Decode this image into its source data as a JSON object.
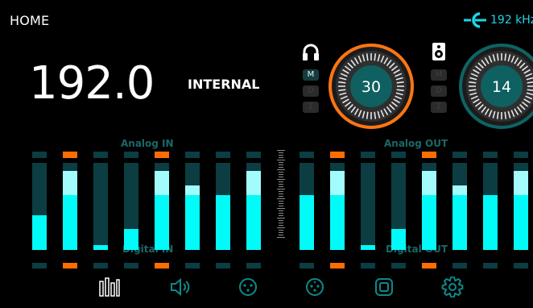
{
  "header": {
    "title": "HOME",
    "sample_rate": "192 kHz"
  },
  "source": {
    "frequency": "192.0",
    "clock": "INTERNAL"
  },
  "headphone": {
    "icon": "headphones-icon",
    "volume": "30",
    "modes": [
      "M",
      "D",
      "Σ"
    ],
    "active_mode": 0
  },
  "speaker": {
    "icon": "speaker-icon",
    "volume": "14",
    "modes": [
      "M",
      "D",
      "Σ"
    ],
    "active_mode": -1
  },
  "sections": {
    "analog_in": "Analog IN",
    "analog_out": "Analog OUT",
    "digital_in": "Digital IN",
    "digital_out": "Digital OUT"
  },
  "colors": {
    "accent": "#00fbf9",
    "peak": "#ff6d00",
    "bar_bg": "#0b3d42",
    "ring": "#ff7512"
  },
  "meters": {
    "inputs": [
      {
        "level": 0.4,
        "hold": 0.4,
        "peak": false,
        "digital": false
      },
      {
        "level": 0.63,
        "hold": 0.91,
        "peak": true,
        "digital": true
      },
      {
        "level": 0.06,
        "hold": 0.06,
        "peak": false,
        "digital": false
      },
      {
        "level": 0.24,
        "hold": 0.24,
        "peak": false,
        "digital": false
      },
      {
        "level": 0.63,
        "hold": 0.91,
        "peak": true,
        "digital": true
      },
      {
        "level": 0.63,
        "hold": 0.74,
        "peak": false,
        "digital": false
      },
      {
        "level": 0.63,
        "hold": 0.63,
        "peak": false,
        "digital": false
      },
      {
        "level": 0.63,
        "hold": 0.91,
        "peak": false,
        "digital": false
      }
    ],
    "outputs": [
      {
        "level": 0.63,
        "hold": 0.63,
        "peak": false,
        "digital": false
      },
      {
        "level": 0.63,
        "hold": 0.91,
        "peak": true,
        "digital": true
      },
      {
        "level": 0.06,
        "hold": 0.06,
        "peak": false,
        "digital": false
      },
      {
        "level": 0.24,
        "hold": 0.24,
        "peak": false,
        "digital": false
      },
      {
        "level": 0.63,
        "hold": 0.91,
        "peak": true,
        "digital": true
      },
      {
        "level": 0.63,
        "hold": 0.74,
        "peak": false,
        "digital": false
      },
      {
        "level": 0.63,
        "hold": 0.63,
        "peak": false,
        "digital": false
      },
      {
        "level": 0.63,
        "hold": 0.91,
        "peak": false,
        "digital": false
      }
    ]
  },
  "nav": [
    {
      "icon": "meters-icon",
      "active": true
    },
    {
      "icon": "speaker-volume-icon",
      "active": false
    },
    {
      "icon": "xlr-input-icon",
      "active": false
    },
    {
      "icon": "xlr-output-icon",
      "active": false
    },
    {
      "icon": "device-icon",
      "active": false
    },
    {
      "icon": "settings-gear-icon",
      "active": false
    }
  ]
}
